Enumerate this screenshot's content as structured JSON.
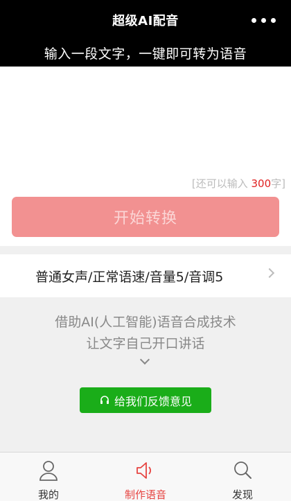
{
  "header": {
    "title": "超级AI配音",
    "subtitle": "输入一段文字，一键即可转为语音"
  },
  "editor": {
    "text": "",
    "counter_prefix": "[还可以输入 ",
    "counter_count": "300",
    "counter_suffix": "字]",
    "convert_label": "开始转换"
  },
  "voice_settings": {
    "label": "普通女声/正常语速/音量5/音调5"
  },
  "info": {
    "line1": "借助AI(人工智能)语音合成技术",
    "line2": "让文字自己开口讲话"
  },
  "feedback": {
    "label": "给我们反馈意见"
  },
  "tabs": [
    {
      "label": "我的",
      "icon": "user-icon"
    },
    {
      "label": "制作语音",
      "icon": "speaker-icon"
    },
    {
      "label": "发现",
      "icon": "search-icon"
    }
  ],
  "colors": {
    "accent": "#e64340",
    "convert_button": "#f29191",
    "feedback_button": "#1aad19",
    "header_bg": "#000000"
  }
}
